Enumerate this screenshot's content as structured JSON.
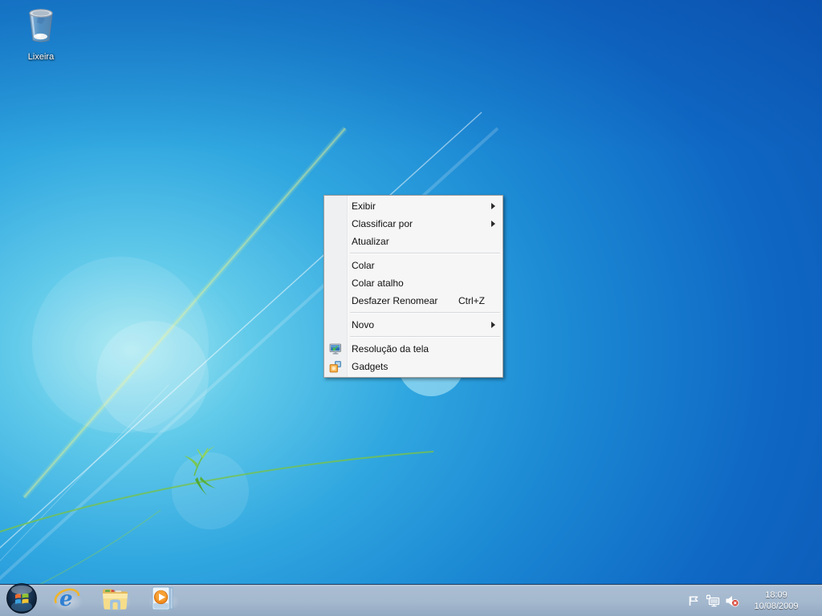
{
  "desktop": {
    "icons": [
      {
        "name": "recycle-bin",
        "label": "Lixeira"
      }
    ]
  },
  "context_menu": {
    "items": [
      {
        "label": "Exibir",
        "submenu": true
      },
      {
        "label": "Classificar por",
        "submenu": true
      },
      {
        "label": "Atualizar"
      },
      {
        "separator": true
      },
      {
        "label": "Colar"
      },
      {
        "label": "Colar atalho"
      },
      {
        "label": "Desfazer Renomear",
        "shortcut": "Ctrl+Z"
      },
      {
        "separator": true
      },
      {
        "label": "Novo",
        "submenu": true
      },
      {
        "separator": true
      },
      {
        "label": "Resolução da tela",
        "icon": "screen-resolution-icon"
      },
      {
        "label": "Gadgets",
        "icon": "gadgets-icon"
      }
    ]
  },
  "taskbar": {
    "start_button": "start-orb",
    "pinned_apps": [
      "internet-explorer",
      "windows-explorer",
      "windows-media-player"
    ],
    "tray": {
      "icons": [
        "action-center-flag",
        "network",
        "volume-muted"
      ],
      "clock": {
        "time": "18:09",
        "date": "10/08/2009"
      }
    }
  },
  "colors": {
    "wallpaper_dark_blue": "#0c59b6",
    "wallpaper_bright_cyan": "#9ae4f0",
    "vine_green": "#76c24c",
    "taskbar_tint": "#a6b9cf",
    "menu_bg": "#f6f6f7",
    "menu_border": "#9e9e9e"
  }
}
